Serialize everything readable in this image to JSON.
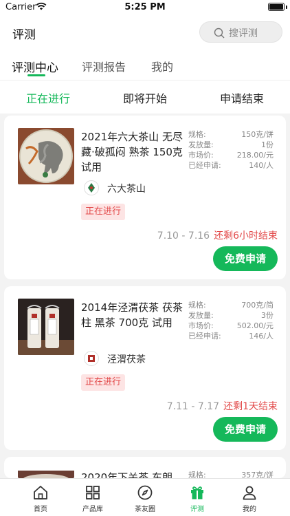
{
  "status_bar": {
    "carrier": "Carrier",
    "time": "5:25 PM"
  },
  "nav": {
    "title": "评测",
    "search_placeholder": "搜评测"
  },
  "top_tabs": [
    {
      "label": "评测中心",
      "active": true
    },
    {
      "label": "评测报告",
      "active": false
    },
    {
      "label": "我的",
      "active": false
    }
  ],
  "sub_tabs": [
    {
      "label": "正在进行",
      "active": true
    },
    {
      "label": "即将开始",
      "active": false
    },
    {
      "label": "申请结束",
      "active": false
    }
  ],
  "spec_labels": {
    "spec": "规格:",
    "quantity": "发放量:",
    "price": "市场价:",
    "applied": "已经申请:"
  },
  "items": [
    {
      "title": "2021年六大茶山 无尽藏·破孤闷 熟茶 150克 试用",
      "brand": "六大茶山",
      "status": "正在进行",
      "spec": "150克/饼",
      "quantity": "1份",
      "price": "218.00/元",
      "applied": "140/人",
      "dates": "7.10 - 7.16",
      "remaining": "还剩6小时结束",
      "button": "免费申请"
    },
    {
      "title": "2014年泾渭茯茶 茯茶柱 黑茶 700克 试用",
      "brand": "泾渭茯茶",
      "status": "正在进行",
      "spec": "700克/简",
      "quantity": "3份",
      "price": "502.00/元",
      "applied": "146/人",
      "dates": "7.11 - 7.17",
      "remaining": "还剩1天结束",
      "button": "免费申请"
    },
    {
      "title": "2020年下关茶 东朗",
      "spec": "357克/饼"
    }
  ],
  "tab_bar": [
    {
      "label": "首页",
      "icon": "home-icon",
      "active": false
    },
    {
      "label": "产品库",
      "icon": "grid-icon",
      "active": false
    },
    {
      "label": "茶友圈",
      "icon": "compass-icon",
      "active": false
    },
    {
      "label": "评测",
      "icon": "gift-icon",
      "active": true
    },
    {
      "label": "我的",
      "icon": "user-icon",
      "active": false
    }
  ],
  "colors": {
    "accent": "#15b85a",
    "alert": "#e24848",
    "badge_bg": "#fde4e4"
  }
}
